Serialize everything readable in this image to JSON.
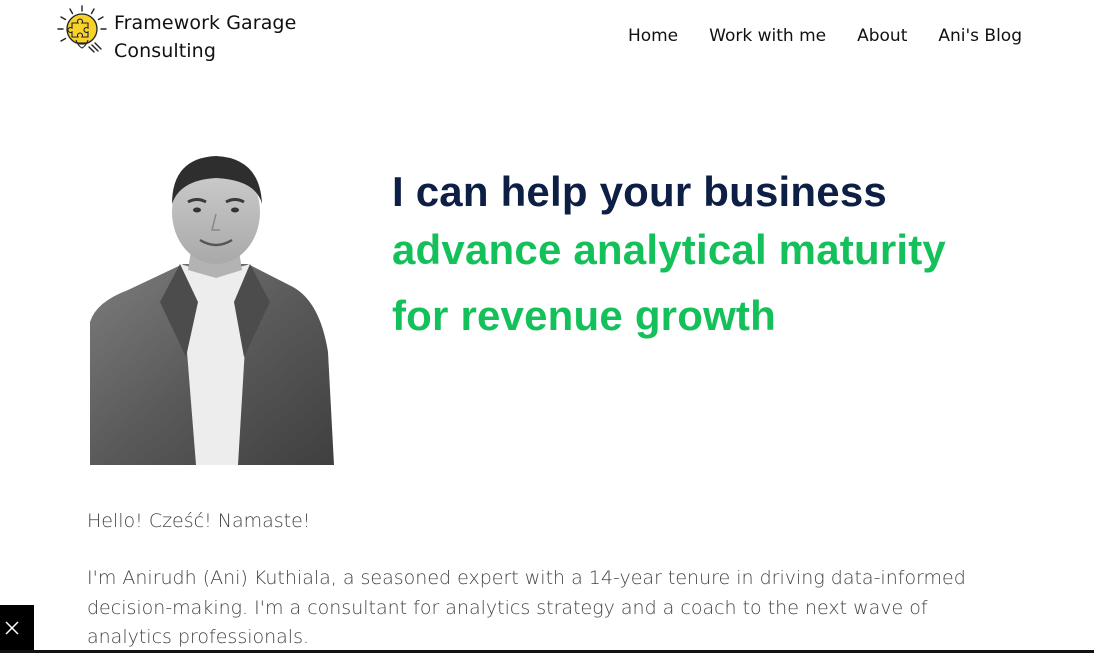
{
  "header": {
    "brand_line1": "Framework Garage",
    "brand_line2": "Consulting",
    "logo_icon": "lightbulb-puzzle-icon",
    "nav": [
      {
        "label": "Home"
      },
      {
        "label": "Work with me"
      },
      {
        "label": "About"
      },
      {
        "label": "Ani's Blog"
      }
    ]
  },
  "hero": {
    "headline_line1": "I can help your business",
    "headline_line2": "advance analytical maturity",
    "headline_line3": "for revenue growth",
    "colors": {
      "headline_dark": "#0e1f45",
      "headline_green": "#14c05a"
    }
  },
  "intro": {
    "greeting": "Hello! Cześć! Namaste!",
    "bio": "I'm Anirudh (Ani) Kuthiala, a seasoned expert with a 14-year tenure in driving data-informed decision-making. I'm a consultant for analytics strategy and a coach to the next wave of analytics professionals."
  },
  "overlay": {
    "close_icon": "close-icon"
  }
}
